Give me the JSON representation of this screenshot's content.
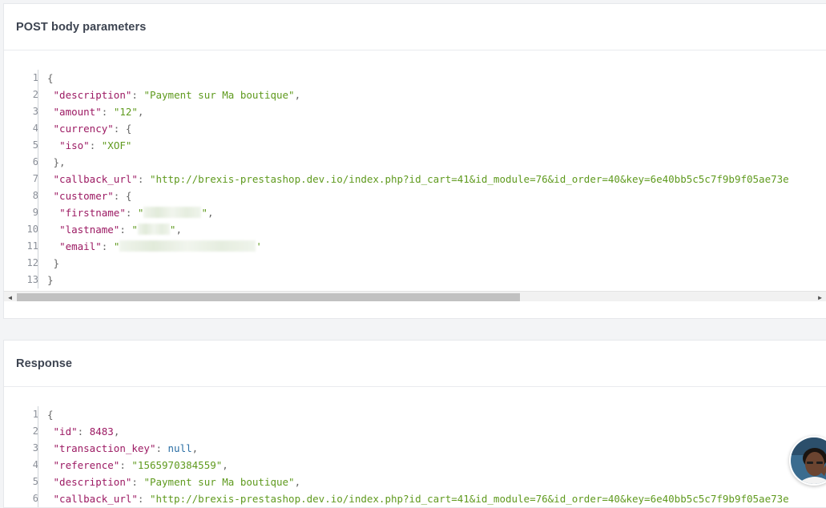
{
  "request_panel": {
    "title": "POST body parameters",
    "line_numbers": [
      "1",
      "2",
      "3",
      "4",
      "5",
      "6",
      "7",
      "8",
      "9",
      "10",
      "11",
      "12",
      "13"
    ],
    "lines": [
      [
        [
          "p",
          "{"
        ]
      ],
      [
        [
          "p",
          " "
        ],
        [
          "k",
          "\"description\""
        ],
        [
          "p",
          ": "
        ],
        [
          "s",
          "\"Payment sur Ma boutique\""
        ],
        [
          "p",
          ","
        ]
      ],
      [
        [
          "p",
          " "
        ],
        [
          "k",
          "\"amount\""
        ],
        [
          "p",
          ": "
        ],
        [
          "s",
          "\"12\""
        ],
        [
          "p",
          ","
        ]
      ],
      [
        [
          "p",
          " "
        ],
        [
          "k",
          "\"currency\""
        ],
        [
          "p",
          ": {"
        ]
      ],
      [
        [
          "p",
          "  "
        ],
        [
          "k",
          "\"iso\""
        ],
        [
          "p",
          ": "
        ],
        [
          "s",
          "\"XOF\""
        ]
      ],
      [
        [
          "p",
          " },"
        ]
      ],
      [
        [
          "p",
          " "
        ],
        [
          "k",
          "\"callback_url\""
        ],
        [
          "p",
          ": "
        ],
        [
          "s",
          "\"http://brexis-prestashop.dev.io/index.php?id_cart=41&id_module=76&id_order=40&key=6e40bb5c5c7f9b9f05ae73e"
        ]
      ],
      [
        [
          "p",
          " "
        ],
        [
          "k",
          "\"customer\""
        ],
        [
          "p",
          ": {"
        ]
      ],
      [
        [
          "p",
          "  "
        ],
        [
          "k",
          "\"firstname\""
        ],
        [
          "p",
          ": "
        ],
        [
          "s",
          "\""
        ],
        [
          "blur",
          "72"
        ],
        [
          "s",
          "\""
        ],
        [
          "p",
          ","
        ]
      ],
      [
        [
          "p",
          "  "
        ],
        [
          "k",
          "\"lastname\""
        ],
        [
          "p",
          ": "
        ],
        [
          "s",
          "\""
        ],
        [
          "blur",
          "40"
        ],
        [
          "s",
          "\""
        ],
        [
          "p",
          ","
        ]
      ],
      [
        [
          "p",
          "  "
        ],
        [
          "k",
          "\"email\""
        ],
        [
          "p",
          ": "
        ],
        [
          "s",
          "\""
        ],
        [
          "blur",
          "170"
        ],
        [
          "s",
          "'"
        ]
      ],
      [
        [
          "p",
          " }"
        ]
      ],
      [
        [
          "p",
          "}"
        ]
      ]
    ]
  },
  "response_panel": {
    "title": "Response",
    "line_numbers": [
      "1",
      "2",
      "3",
      "4",
      "5",
      "6"
    ],
    "lines": [
      [
        [
          "p",
          "{"
        ]
      ],
      [
        [
          "p",
          " "
        ],
        [
          "k",
          "\"id\""
        ],
        [
          "p",
          ": "
        ],
        [
          "n",
          "8483"
        ],
        [
          "p",
          ","
        ]
      ],
      [
        [
          "p",
          " "
        ],
        [
          "k",
          "\"transaction_key\""
        ],
        [
          "p",
          ": "
        ],
        [
          "nl",
          "null"
        ],
        [
          "p",
          ","
        ]
      ],
      [
        [
          "p",
          " "
        ],
        [
          "k",
          "\"reference\""
        ],
        [
          "p",
          ": "
        ],
        [
          "s",
          "\"1565970384559\""
        ],
        [
          "p",
          ","
        ]
      ],
      [
        [
          "p",
          " "
        ],
        [
          "k",
          "\"description\""
        ],
        [
          "p",
          ": "
        ],
        [
          "s",
          "\"Payment sur Ma boutique\""
        ],
        [
          "p",
          ","
        ]
      ],
      [
        [
          "p",
          " "
        ],
        [
          "k",
          "\"callback_url\""
        ],
        [
          "p",
          ": "
        ],
        [
          "s",
          "\"http://brexis-prestashop.dev.io/index.php?id_cart=41&id_module=76&id_order=40&key=6e40bb5c5c7f9b9f05ae73e"
        ]
      ]
    ]
  },
  "scrollbar": {
    "left_arrow": "◀",
    "right_arrow": "▶"
  },
  "icons": {
    "avatar": "chat-avatar-icon"
  },
  "colors": {
    "key": "#9c1a63",
    "string": "#5f9a1e",
    "null": "#2b6fa5",
    "punctuation": "#666666",
    "line_number": "#8a8f98"
  }
}
